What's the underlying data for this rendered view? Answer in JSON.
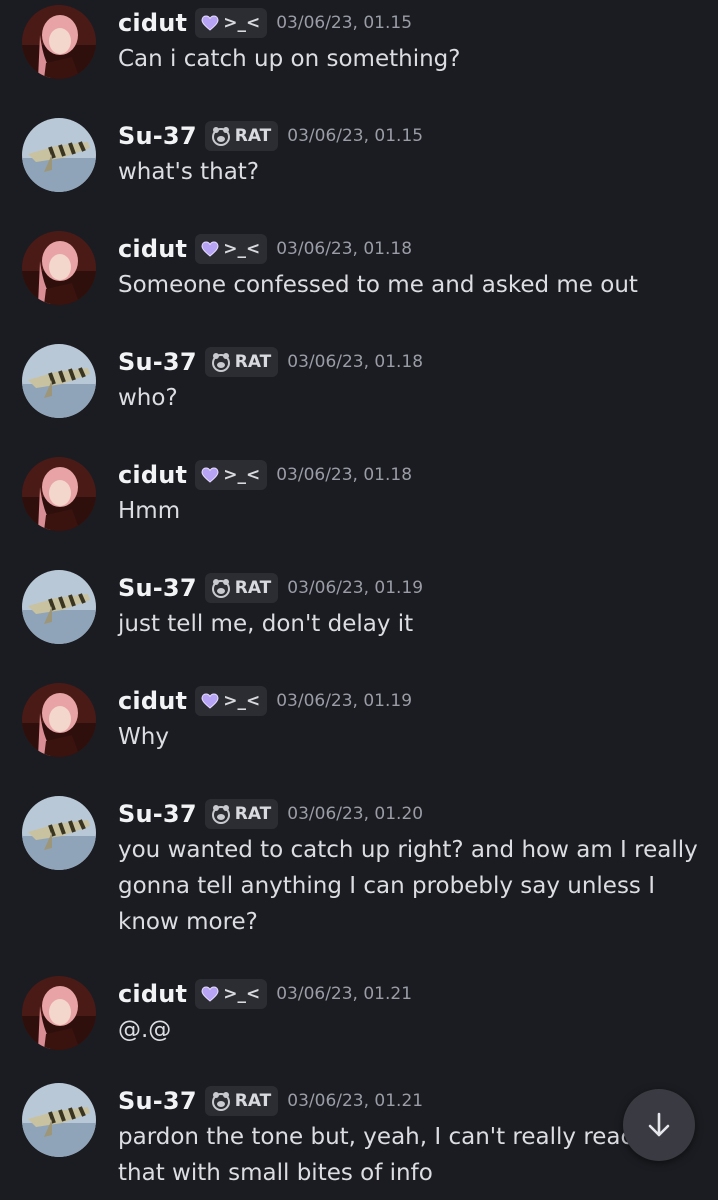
{
  "users": {
    "cidut": {
      "name": "cidut",
      "tag": ">_<",
      "tag_icon": "heart-icon",
      "tag_color": "#b7a4f5"
    },
    "su37": {
      "name": "Su-37",
      "tag": "RAT",
      "tag_icon": "rat-icon",
      "tag_color": "#c9cacf"
    }
  },
  "messages": [
    {
      "author": "cidut",
      "tag": ">_<",
      "time": "03/06/23, 01.15",
      "text": [
        "Can i catch up on something?"
      ]
    },
    {
      "author": "Su-37",
      "tag": "RAT",
      "time": "03/06/23, 01.15",
      "text": [
        "what's that?"
      ]
    },
    {
      "author": "cidut",
      "tag": ">_<",
      "time": "03/06/23, 01.18",
      "text": [
        "Someone confessed to me and asked me out"
      ]
    },
    {
      "author": "Su-37",
      "tag": "RAT",
      "time": "03/06/23, 01.18",
      "text": [
        "who?"
      ]
    },
    {
      "author": "cidut",
      "tag": ">_<",
      "time": "03/06/23, 01.18",
      "text": [
        "Hmm"
      ]
    },
    {
      "author": "Su-37",
      "tag": "RAT",
      "time": "03/06/23, 01.19",
      "text": [
        "just tell me, don't delay it"
      ]
    },
    {
      "author": "cidut",
      "tag": ">_<",
      "time": "03/06/23, 01.19",
      "text": [
        "Why"
      ]
    },
    {
      "author": "Su-37",
      "tag": "RAT",
      "time": "03/06/23, 01.20",
      "text": [
        "you wanted to catch up right? and how am I really",
        "gonna tell anything I can probebly say unless I",
        "know more?"
      ]
    },
    {
      "author": "cidut",
      "tag": ">_<",
      "time": "03/06/23, 01.21",
      "text": [
        "@.@"
      ]
    },
    {
      "author": "Su-37",
      "tag": "RAT",
      "time": "03/06/23, 01.21",
      "text": [
        "pardon the tone but, yeah, I can't really reac",
        "that with small bites of info"
      ]
    }
  ],
  "controls": {
    "scroll_button_icon": "arrow-down-icon"
  },
  "colors": {
    "background": "#1b1c21",
    "username": "#f2f3f5",
    "timestamp": "#9a9ca6",
    "message_text": "#dcdde3",
    "tag_background": "#2c2d33"
  }
}
